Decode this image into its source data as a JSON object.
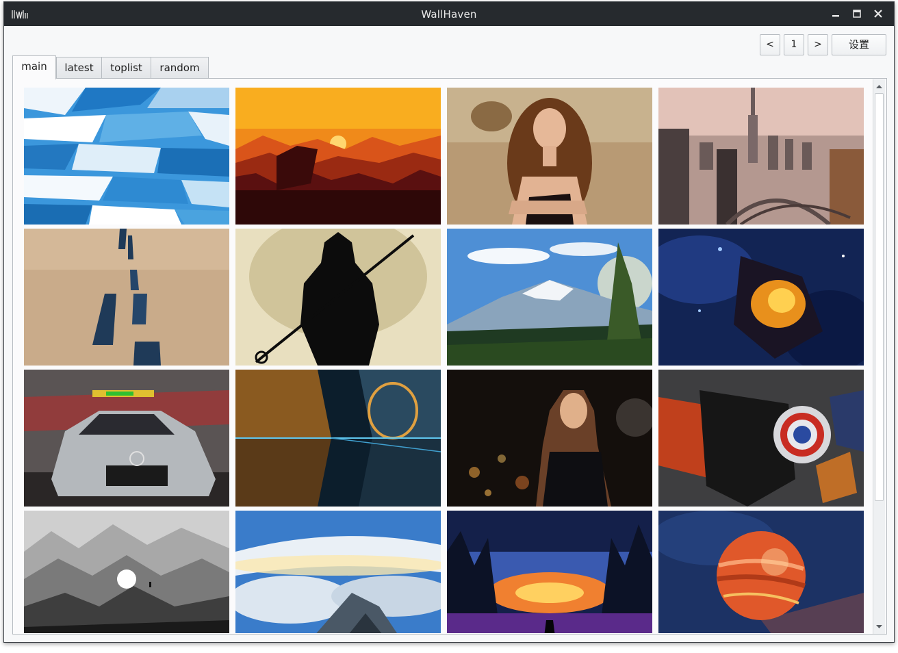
{
  "window": {
    "title": "WallHaven",
    "logo_text": "wallhaven"
  },
  "toolbar": {
    "prev_label": "<",
    "page_number": "1",
    "next_label": ">",
    "settings_label": "设置"
  },
  "tabs": [
    {
      "label": "main",
      "active": true
    },
    {
      "label": "latest",
      "active": false
    },
    {
      "label": "toplist",
      "active": false
    },
    {
      "label": "random",
      "active": false
    }
  ],
  "wallpapers": [
    {
      "subject": "blue-geometric-shards",
      "colors": [
        "#2f8fd8",
        "#ffffff"
      ]
    },
    {
      "subject": "orange-sunset-silhouette",
      "colors": [
        "#f5a623",
        "#3a0a0a"
      ]
    },
    {
      "subject": "curly-haired-woman-field",
      "colors": [
        "#b69870",
        "#3a2414"
      ]
    },
    {
      "subject": "dubai-city-skyline",
      "colors": [
        "#d8b8b0",
        "#4a4040"
      ]
    },
    {
      "subject": "desert-road",
      "colors": [
        "#c9ab8c",
        "#1f3a55"
      ]
    },
    {
      "subject": "samurai-silhouette",
      "colors": [
        "#e8e0c0",
        "#0c0c0c"
      ]
    },
    {
      "subject": "snowy-mountain-forest",
      "colors": [
        "#4f8fd6",
        "#1f3a20"
      ]
    },
    {
      "subject": "cosmic-fire-creature",
      "colors": [
        "#142a6a",
        "#f0a020"
      ]
    },
    {
      "subject": "amg-safety-car",
      "colors": [
        "#7a7070",
        "#c03030"
      ]
    },
    {
      "subject": "futuristic-neon-city",
      "colors": [
        "#0c2030",
        "#e0a040"
      ]
    },
    {
      "subject": "woman-city-lights-night",
      "colors": [
        "#1a1410",
        "#e09a40"
      ]
    },
    {
      "subject": "black-panther-captain-america",
      "colors": [
        "#3a3a3a",
        "#c83020"
      ]
    },
    {
      "subject": "misty-grey-mountains-moon",
      "colors": [
        "#c8c8c8",
        "#1a1a1a"
      ]
    },
    {
      "subject": "sea-of-clouds",
      "colors": [
        "#3a78c8",
        "#e8eef4"
      ]
    },
    {
      "subject": "neon-forest-sunset",
      "colors": [
        "#101a40",
        "#f07a30"
      ]
    },
    {
      "subject": "red-gas-giant-planet",
      "colors": [
        "#1a3060",
        "#e85a30"
      ]
    }
  ]
}
